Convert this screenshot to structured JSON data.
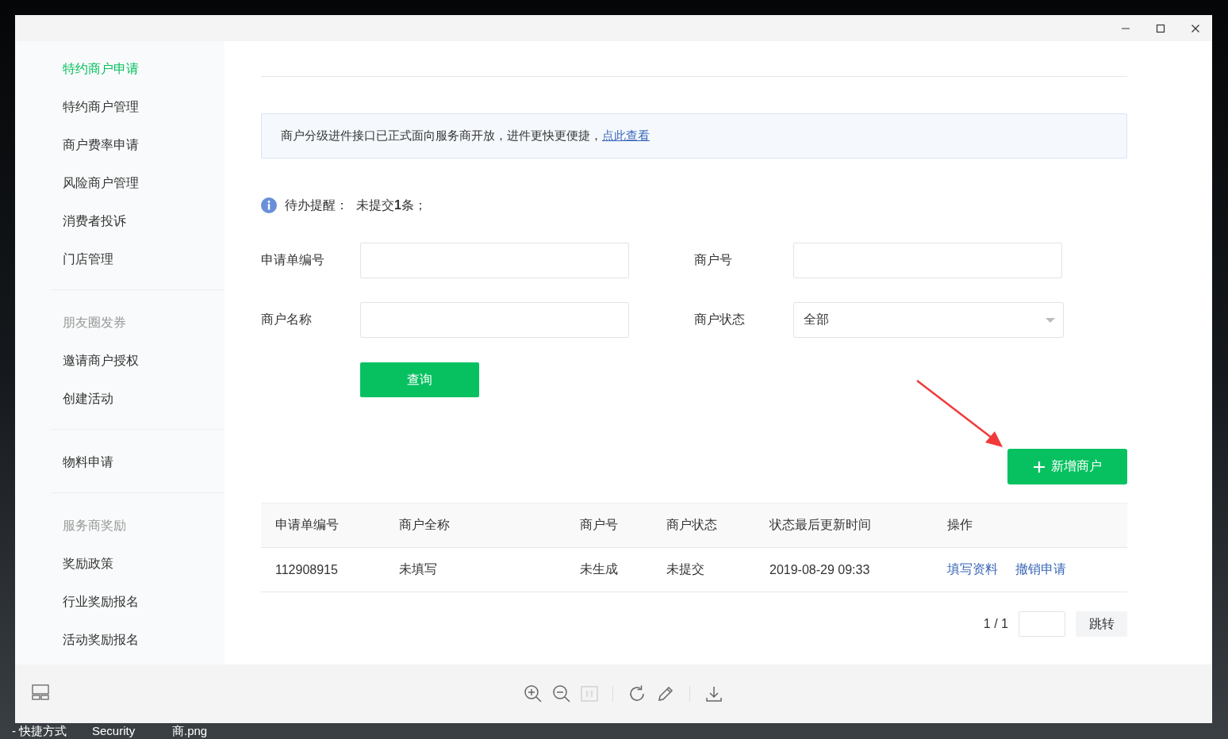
{
  "desktop": {
    "bottom_labels": [
      "- 快捷方式",
      "Security",
      "商.png"
    ]
  },
  "sidebar": {
    "groups": [
      {
        "items": [
          {
            "label": "特约商户申请",
            "selected": true
          },
          {
            "label": "特约商户管理",
            "selected": false
          },
          {
            "label": "商户费率申请",
            "selected": false
          },
          {
            "label": "风险商户管理",
            "selected": false
          },
          {
            "label": "消费者投诉",
            "selected": false
          },
          {
            "label": "门店管理",
            "selected": false
          }
        ]
      },
      {
        "header": "朋友圈发券",
        "items": [
          {
            "label": "邀请商户授权",
            "selected": false
          },
          {
            "label": "创建活动",
            "selected": false
          }
        ]
      },
      {
        "items": [
          {
            "label": "物料申请",
            "selected": false
          }
        ]
      },
      {
        "header": "服务商奖励",
        "items": [
          {
            "label": "奖励政策",
            "selected": false
          },
          {
            "label": "行业奖励报名",
            "selected": false
          },
          {
            "label": "活动奖励报名",
            "selected": false
          }
        ]
      }
    ]
  },
  "notice": {
    "text": "商户分级进件接口已正式面向服务商开放，进件更快更便捷，",
    "link": "点此查看"
  },
  "reminder": {
    "label": "待办提醒：",
    "text": "未提交**1**条；"
  },
  "form": {
    "rows": [
      [
        {
          "label": "申请单编号",
          "kind": "text"
        },
        {
          "label": "商户号",
          "kind": "text"
        }
      ],
      [
        {
          "label": "商户名称",
          "kind": "text"
        },
        {
          "label": "商户状态",
          "kind": "select",
          "value": "全部"
        }
      ]
    ],
    "query_button": "查询"
  },
  "add_button": "新增商户",
  "table": {
    "columns": [
      "申请单编号",
      "商户全称",
      "商户号",
      "商户状态",
      "状态最后更新时间",
      "操作"
    ],
    "rows": [
      {
        "cells": [
          "112908915",
          "未填写",
          "未生成",
          "未提交",
          "2019-08-29 09:33"
        ],
        "actions": [
          "填写资料",
          "撤销申请"
        ]
      }
    ]
  },
  "pagination": {
    "page": "1 / 1",
    "jump_button": "跳转"
  }
}
